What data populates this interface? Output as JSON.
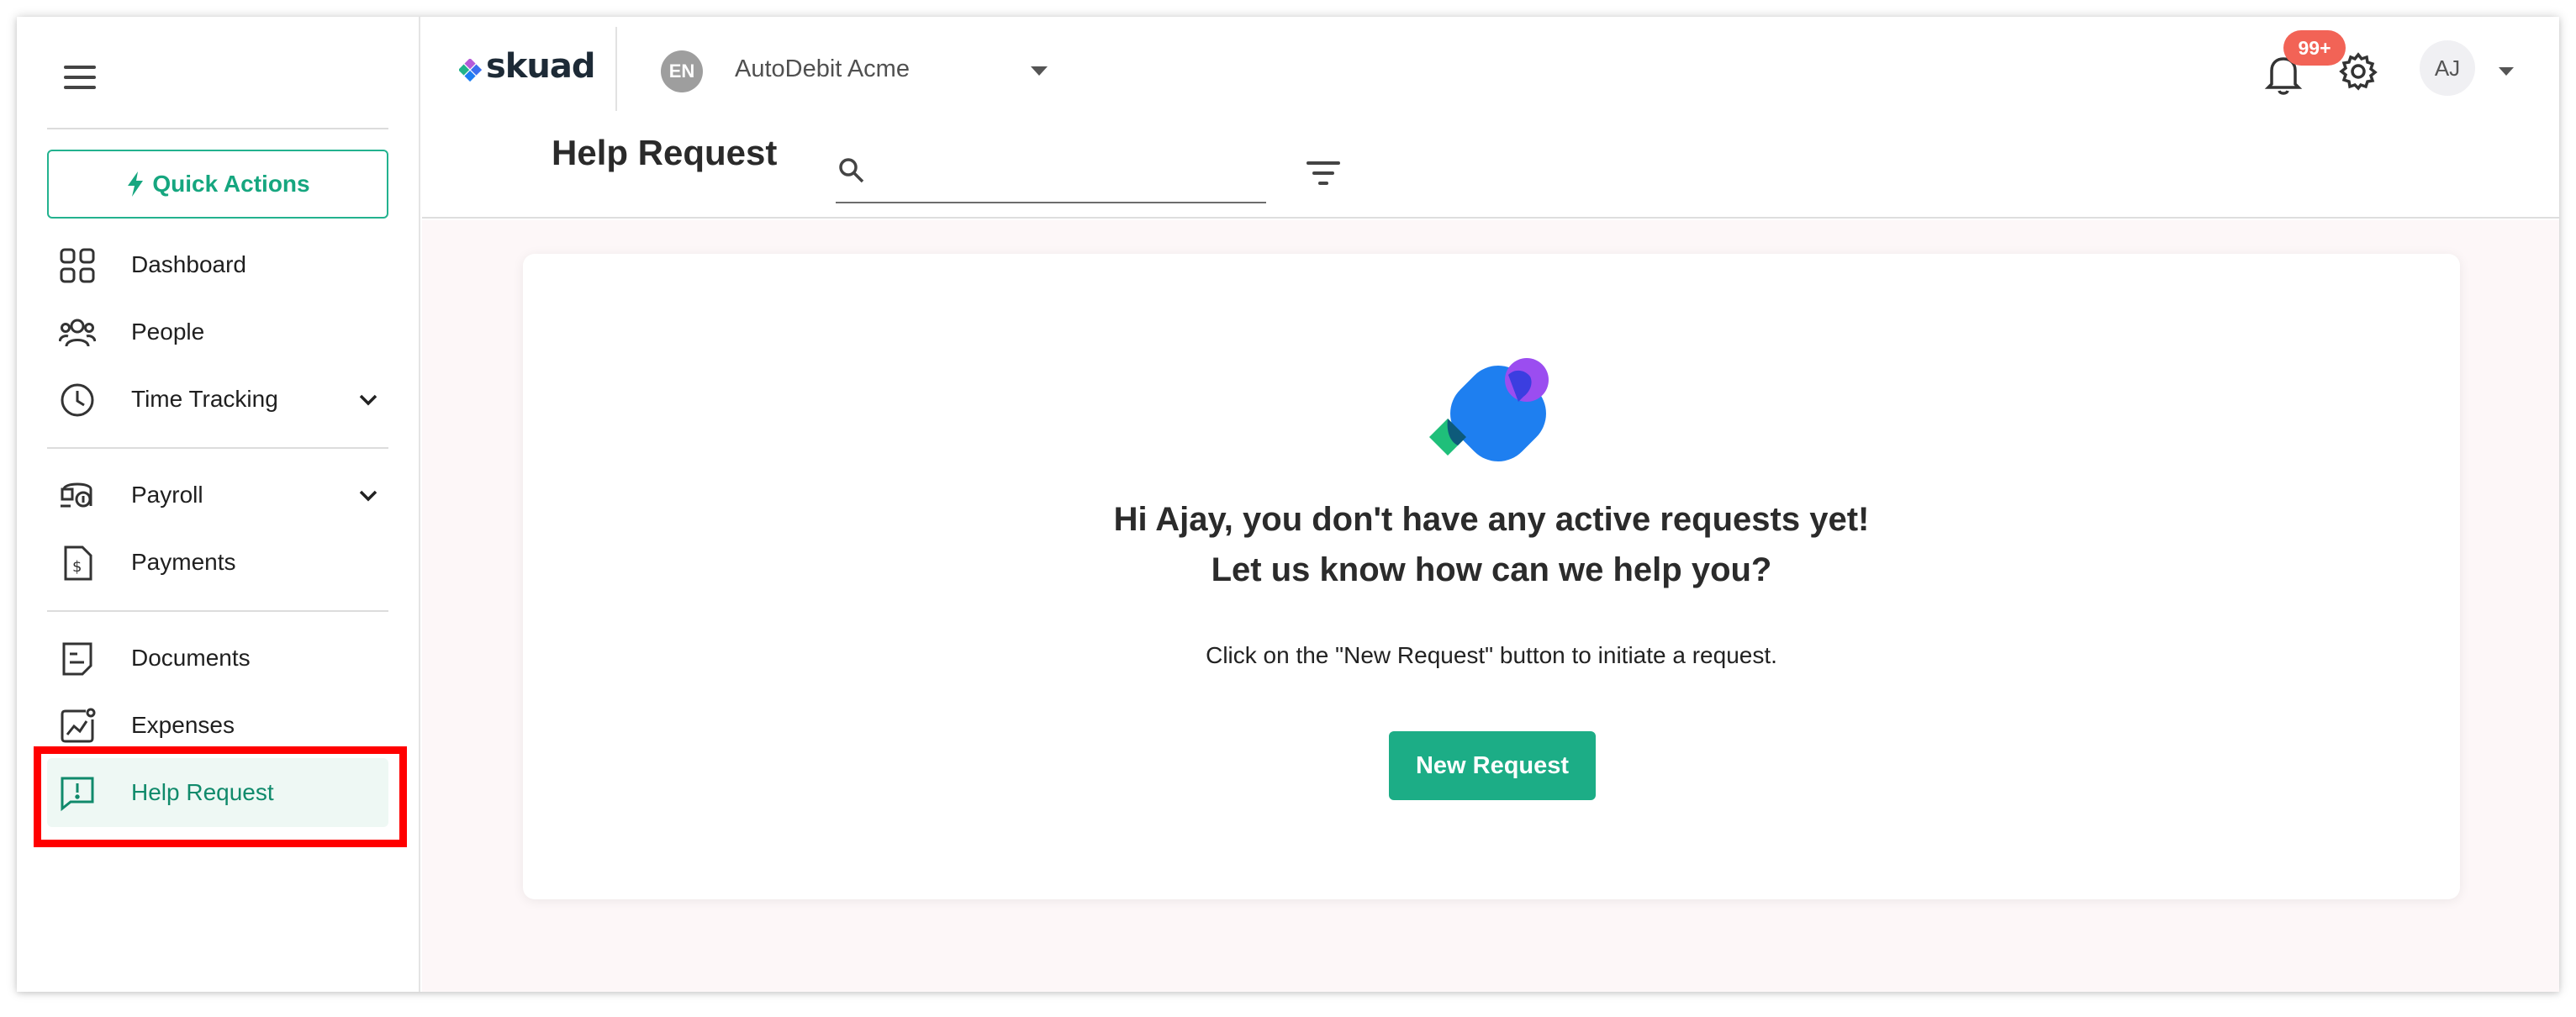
{
  "sidebar": {
    "quick_actions_label": "Quick Actions",
    "items": [
      {
        "label": "Dashboard",
        "icon": "grid-icon"
      },
      {
        "label": "People",
        "icon": "people-icon"
      },
      {
        "label": "Time Tracking",
        "icon": "clock-icon",
        "expandable": true
      },
      {
        "label": "Payroll",
        "icon": "payroll-icon",
        "expandable": true
      },
      {
        "label": "Payments",
        "icon": "dollar-document-icon"
      },
      {
        "label": "Documents",
        "icon": "document-icon"
      },
      {
        "label": "Expenses",
        "icon": "chart-icon"
      },
      {
        "label": "Help Request",
        "icon": "help-message-icon",
        "active": true
      }
    ]
  },
  "header": {
    "logo_text": "skuad",
    "org_badge": "EN",
    "org_name": "AutoDebit Acme",
    "notifications_badge": "99+",
    "avatar_initials": "AJ",
    "page_title": "Help Request",
    "search_value": ""
  },
  "main": {
    "headline_line1": "Hi Ajay, you don't have any active requests yet!",
    "headline_line2": "Let us know how can we help you?",
    "subtext": "Click on the \"New Request\" button to initiate a request.",
    "new_request_label": "New Request"
  },
  "colors": {
    "brand_green": "#1cad86",
    "annotation_red": "#ff0000",
    "notification_red": "#f26356",
    "active_bg": "#eef8f4"
  }
}
